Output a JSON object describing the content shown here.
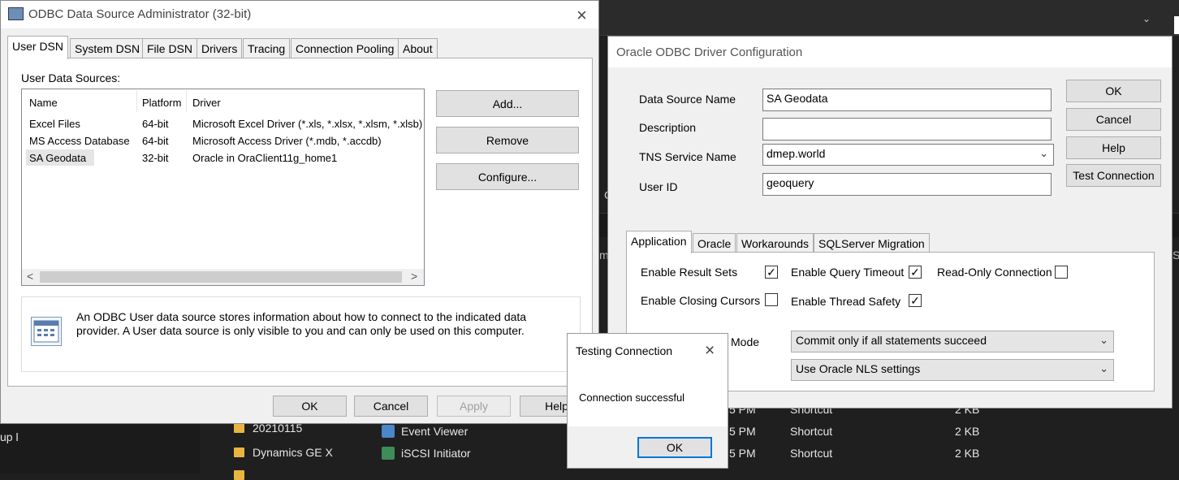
{
  "background": {
    "left_text": "up l",
    "mode_fragment": "Mode",
    "clip_m": "m",
    "clip_s": "S",
    "clip_c": "C",
    "chevron_icon": "chevron-down-icon",
    "rows": [
      {
        "folder": "20210115",
        "app": "Event Viewer",
        "time": "5 PM",
        "type": "Shortcut",
        "size": "2 KB"
      },
      {
        "folder": "Dynamics GE X",
        "app": "iSCSI Initiator",
        "time": "5 PM",
        "type": "Shortcut",
        "size": "2 KB"
      },
      {
        "folder": "",
        "app": "",
        "time": "5 PM",
        "type": "Shortcut",
        "size": "2 KB"
      }
    ],
    "row0_time_full": "5 PM"
  },
  "odbc": {
    "title": "ODBC Data Source Administrator (32-bit)",
    "tabs": [
      "User DSN",
      "System DSN",
      "File DSN",
      "Drivers",
      "Tracing",
      "Connection Pooling",
      "About"
    ],
    "active_tab": "User DSN",
    "list_label": "User Data Sources:",
    "columns": [
      "Name",
      "Platform",
      "Driver"
    ],
    "rows": [
      {
        "name": "Excel Files",
        "platform": "64-bit",
        "driver": "Microsoft Excel Driver (*.xls, *.xlsx, *.xlsm, *.xlsb)"
      },
      {
        "name": "MS Access Database",
        "platform": "64-bit",
        "driver": "Microsoft Access Driver (*.mdb, *.accdb)"
      },
      {
        "name": "SA Geodata",
        "platform": "32-bit",
        "driver": "Oracle in OraClient11g_home1"
      }
    ],
    "selected_row": "SA Geodata",
    "buttons": {
      "add": "Add...",
      "remove": "Remove",
      "configure": "Configure..."
    },
    "info_text": "An ODBC User data source stores information about how to connect to the indicated data provider.   A User data source is only visible to you and can only be used on this computer.",
    "footer": {
      "ok": "OK",
      "cancel": "Cancel",
      "apply": "Apply",
      "help": "Help"
    },
    "scroll_left": "<",
    "scroll_right": ">"
  },
  "oracle": {
    "title": "Oracle ODBC Driver Configuration",
    "fields": {
      "dsn_label": "Data Source Name",
      "dsn_value": "SA Geodata",
      "desc_label": "Description",
      "desc_value": "",
      "tns_label": "TNS Service Name",
      "tns_value": "dmep.world",
      "user_label": "User ID",
      "user_value": "geoquery"
    },
    "buttons": {
      "ok": "OK",
      "cancel": "Cancel",
      "help": "Help",
      "test": "Test Connection"
    },
    "tabs": [
      "Application",
      "Oracle",
      "Workarounds",
      "SQLServer Migration"
    ],
    "active_tab": "Application",
    "options": {
      "result_sets": "Enable Result Sets",
      "query_timeout": "Enable Query Timeout",
      "read_only": "Read-Only Connection",
      "closing_cursors": "Enable Closing Cursors",
      "thread_safety": "Enable Thread Safety"
    },
    "checked": {
      "result_sets": true,
      "query_timeout": true,
      "read_only": false,
      "closing_cursors": false,
      "thread_safety": true
    },
    "check_mark": "✓",
    "commit_mode": "Commit only if all statements succeed",
    "nls": "Use Oracle NLS settings"
  },
  "dialog": {
    "title": "Testing Connection",
    "message": "Connection successful",
    "ok": "OK"
  }
}
